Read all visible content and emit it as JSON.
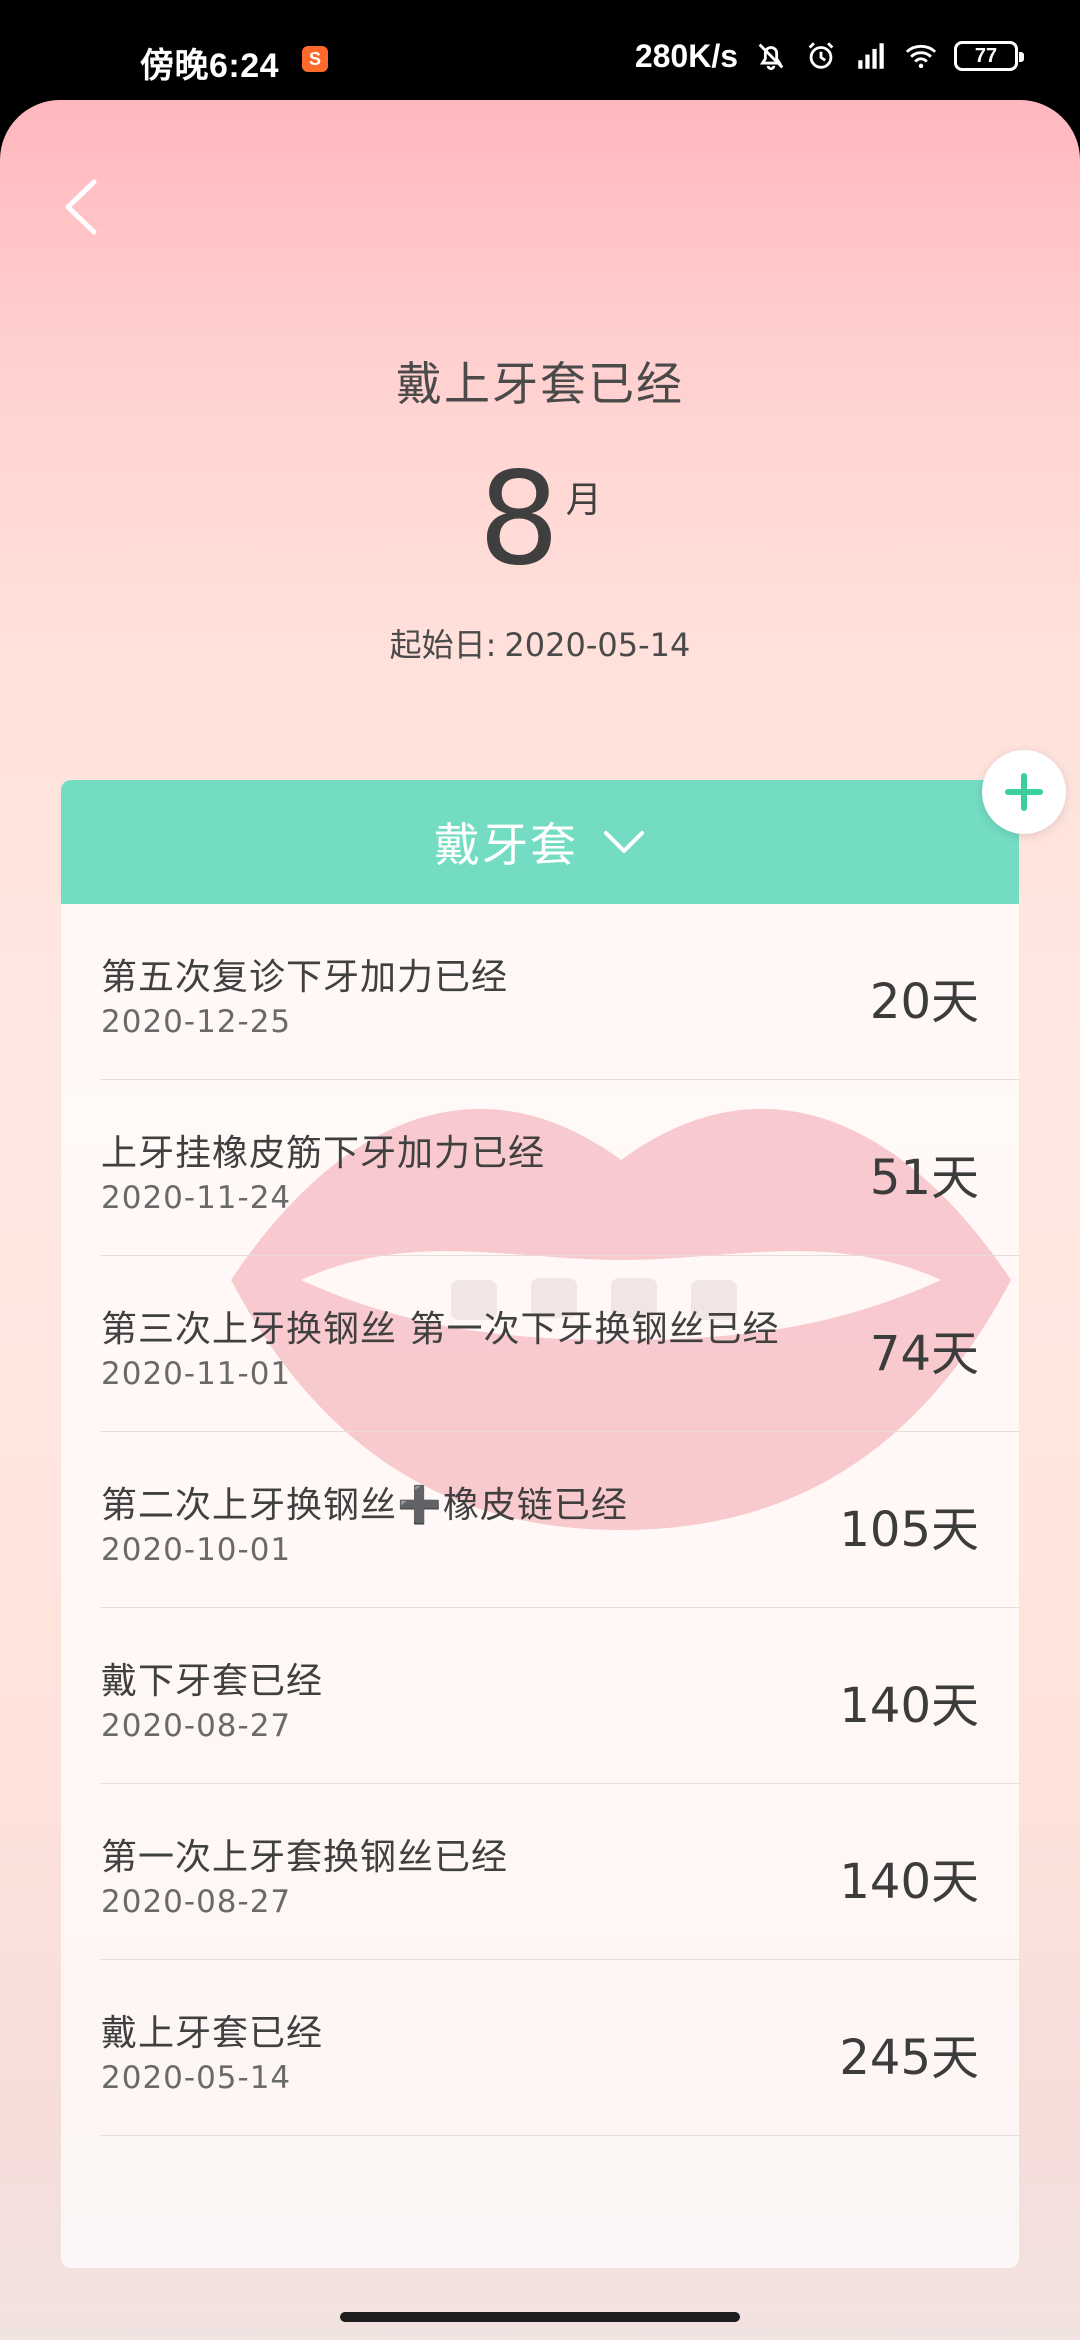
{
  "status_bar": {
    "time": "傍晚6:24",
    "app_badge": "S",
    "net_speed": "280K/s",
    "battery": "77"
  },
  "header": {
    "headline": "戴上牙套已经",
    "count": "8",
    "count_unit": "月",
    "start_label": "起始日:",
    "start_date": "2020-05-14"
  },
  "card": {
    "title": "戴牙套",
    "items": [
      {
        "title": "第五次复诊下牙加力已经",
        "date": "2020-12-25",
        "days": "20天"
      },
      {
        "title": "上牙挂橡皮筋下牙加力已经",
        "date": "2020-11-24",
        "days": "51天"
      },
      {
        "title": "第三次上牙换钢丝 第一次下牙换钢丝已经",
        "date": "2020-11-01",
        "days": "74天"
      },
      {
        "title": "第二次上牙换钢丝➕橡皮链已经",
        "date": "2020-10-01",
        "days": "105天"
      },
      {
        "title": "戴下牙套已经",
        "date": "2020-08-27",
        "days": "140天"
      },
      {
        "title": "第一次上牙套换钢丝已经",
        "date": "2020-08-27",
        "days": "140天"
      },
      {
        "title": "戴上牙套已经",
        "date": "2020-05-14",
        "days": "245天"
      }
    ]
  },
  "icons": {
    "back": "back-arrow-icon",
    "add": "plus-icon",
    "dropdown": "chevron-down-icon"
  },
  "colors": {
    "accent": "#74dcc3",
    "add_icon": "#3ccf9e"
  }
}
